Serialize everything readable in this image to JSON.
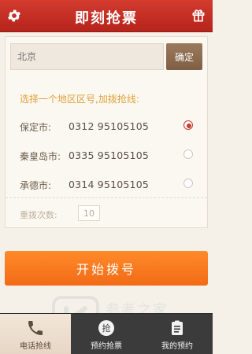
{
  "header": {
    "title": "即刻抢票",
    "left_icon": "gear-icon",
    "right_icon": "gift-icon"
  },
  "search": {
    "value": "",
    "placeholder": "北京",
    "confirm_label": "确定"
  },
  "section": {
    "label": "选择一个地区区号,加拨抢线:"
  },
  "options": [
    {
      "city": "保定市:",
      "number": "0312 95105105",
      "selected": true
    },
    {
      "city": "秦皇岛市:",
      "number": "0335 95105105",
      "selected": false
    },
    {
      "city": "承德市:",
      "number": "0314 95105105",
      "selected": false
    }
  ],
  "retry": {
    "label": "重拨次数:",
    "value": "10"
  },
  "actions": {
    "start_label": "开始拨号"
  },
  "bottom_nav": {
    "items": [
      {
        "label": "电话抢线",
        "icon": "phone-icon",
        "active": true
      },
      {
        "label": "预约抢票",
        "icon": "ticket-grab-icon",
        "active": false
      },
      {
        "label": "我的预约",
        "icon": "clipboard-icon",
        "active": false
      }
    ]
  },
  "watermark": {
    "text": "参考之家",
    "url": "www.ckdzl.com"
  },
  "colors": {
    "header_red": "#c02a20",
    "accent_orange": "#f26b16",
    "label_orange": "#e1a23a",
    "button_brown": "#8b6b4f",
    "radio_red": "#c63c2f",
    "nav_dark": "#3b3b3b",
    "background": "#f6f1e8"
  }
}
